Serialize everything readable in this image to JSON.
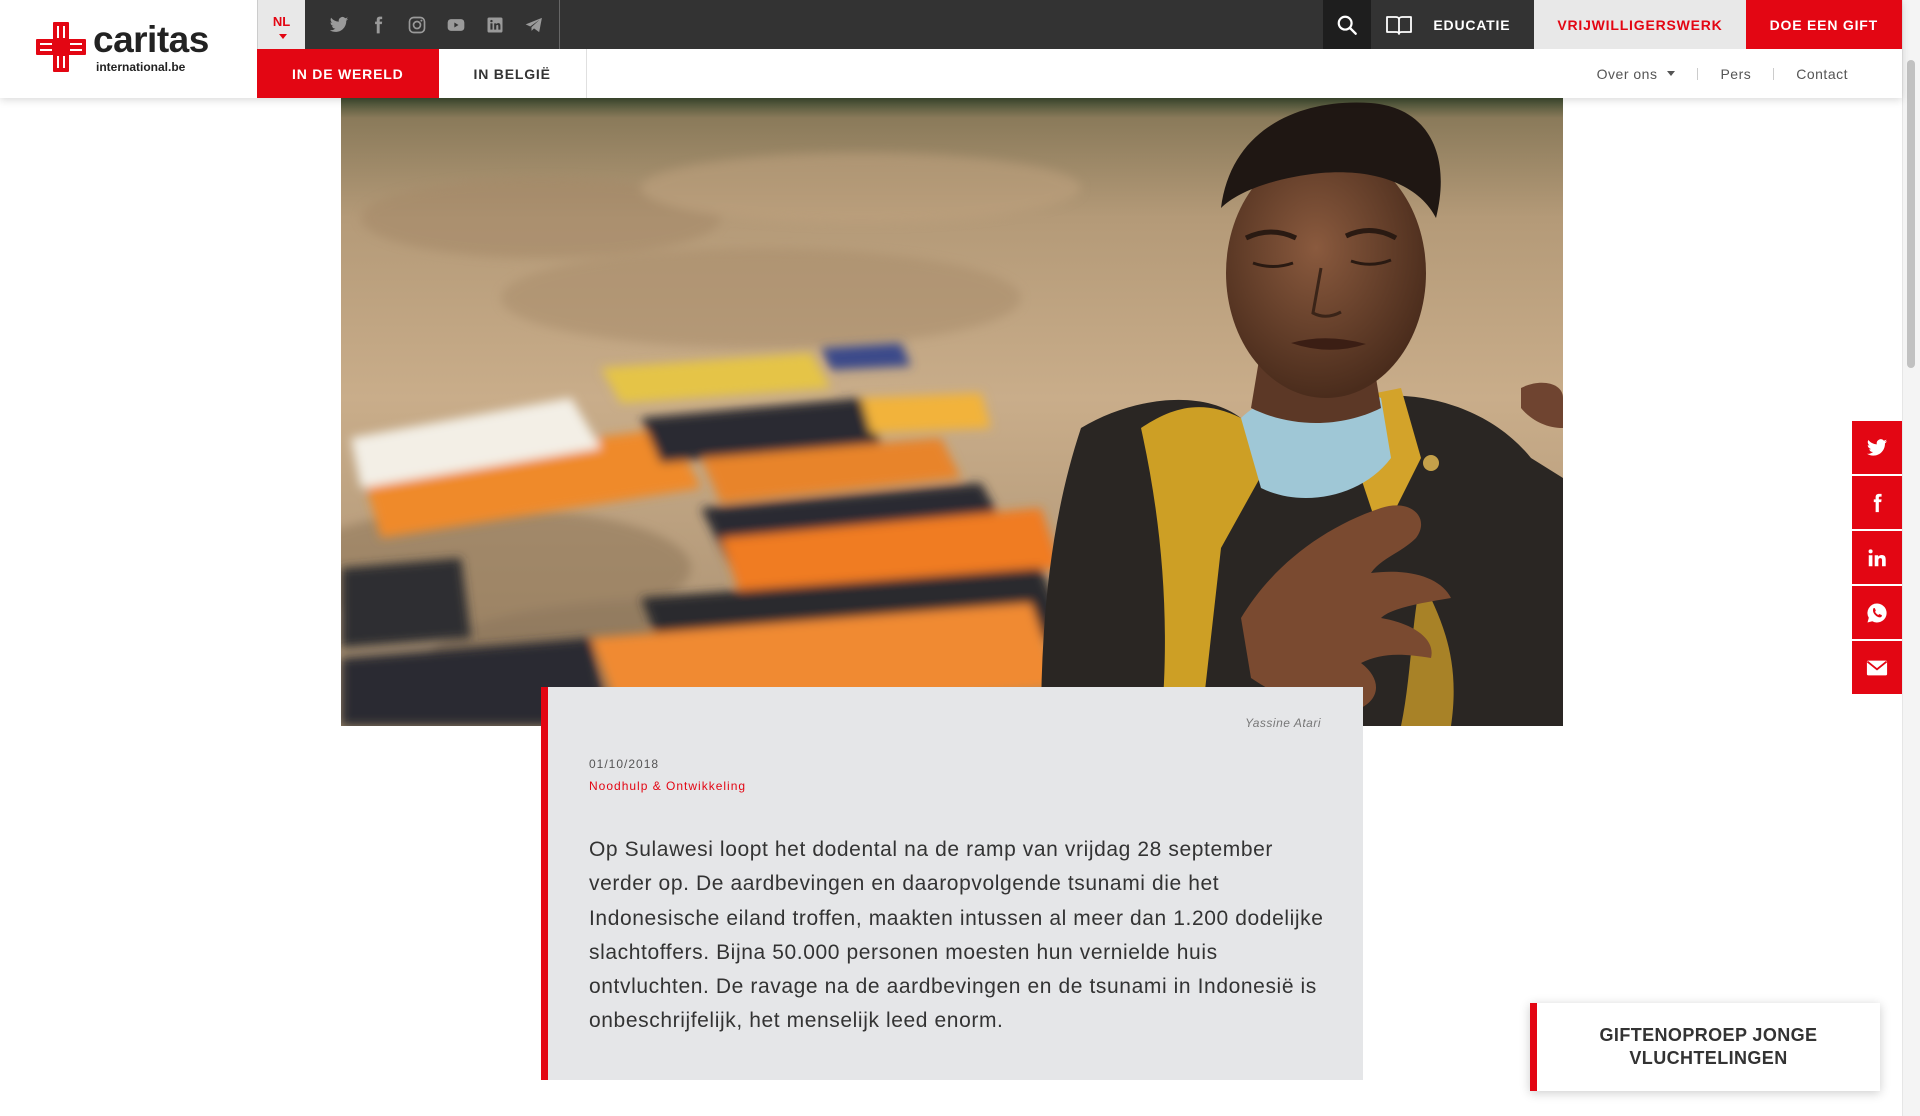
{
  "header": {
    "logo": {
      "word": "caritas",
      "sub": "international.be"
    },
    "language": "NL",
    "social_icons": [
      "twitter-icon",
      "facebook-icon",
      "instagram-icon",
      "youtube-icon",
      "linkedin-icon",
      "telegram-icon"
    ],
    "education_label": "EDUCATIE",
    "volunteer_label": "VRIJWILLIGERSWERK",
    "donate_label": "DOE EEN GIFT",
    "tabs": [
      {
        "label": "IN DE WERELD",
        "active": true
      },
      {
        "label": "IN BELGIË",
        "active": false
      }
    ],
    "meta_nav": {
      "about": "Over ons",
      "press": "Pers",
      "contact": "Contact"
    }
  },
  "article": {
    "photo_credit": "Yassine Atari",
    "date": "01/10/2018",
    "category": "Noodhulp & Ontwikkeling",
    "lead": "Op Sulawesi loopt het dodental na de ramp van vrijdag 28 september verder op. De aardbevingen en daaropvolgende tsunami die het Indonesische eiland troffen, maakten intussen al meer dan 1.200 dodelijke slachtoffers.  Bijna 50.000 personen moesten hun vernielde huis ontvluchten. De ravage na de aardbevingen en de tsunami in Indonesië is onbeschrijfelijk, het menselijk leed enorm."
  },
  "share_icons": [
    "twitter-icon",
    "facebook-icon",
    "linkedin-icon",
    "whatsapp-icon",
    "email-icon"
  ],
  "cta": {
    "label": "GIFTENOPROEP JONGE VLUCHTELINGEN"
  },
  "colors": {
    "brand_red": "#e30613",
    "topbar": "#333333",
    "card_bg": "#e5e6e8"
  }
}
